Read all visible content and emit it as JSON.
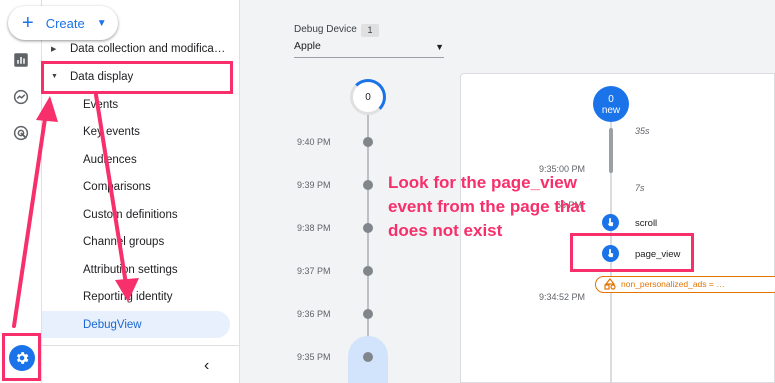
{
  "create_button": {
    "label": "Create",
    "icon": "plus-icon"
  },
  "rail": {
    "icons": [
      "home-icon",
      "reports-icon",
      "explore-icon",
      "advertising-icon"
    ],
    "settings_icon": "gear-icon"
  },
  "sidebar": {
    "items": [
      {
        "label": "Data collection and modifica…",
        "expanded": false
      },
      {
        "label": "Data display",
        "expanded": true
      }
    ],
    "children": [
      {
        "label": "Events"
      },
      {
        "label": "Key events"
      },
      {
        "label": "Audiences"
      },
      {
        "label": "Comparisons"
      },
      {
        "label": "Custom definitions"
      },
      {
        "label": "Channel groups"
      },
      {
        "label": "Attribution settings"
      },
      {
        "label": "Reporting identity"
      },
      {
        "label": "DebugView",
        "active": true
      }
    ],
    "collapse_icon": "chevron-left-icon"
  },
  "debug": {
    "device_label": "Debug Device",
    "device_count": "1",
    "device_value": "Apple"
  },
  "minutes": {
    "current_count": "0",
    "rows": [
      {
        "time": "9:40 PM"
      },
      {
        "time": "9:39 PM"
      },
      {
        "time": "9:38 PM"
      },
      {
        "time": "9:37 PM"
      },
      {
        "time": "9:36 PM"
      },
      {
        "time": "9:35 PM"
      }
    ]
  },
  "seconds": {
    "top_count": "0",
    "top_label": "new",
    "durations": [
      "35s",
      "7s"
    ],
    "times": [
      "9:35:00 PM",
      "53 PM",
      "9:34:52 PM"
    ],
    "events": [
      {
        "label": "scroll",
        "icon": "event-icon"
      },
      {
        "label": "page_view",
        "icon": "event-icon"
      }
    ],
    "warning": {
      "label": "non_personalized_ads = …",
      "icon": "warning-shapes-icon"
    }
  },
  "annotation": {
    "text": "Look for the page_view event from the page that does not exist",
    "color": "#f72f6b"
  },
  "colors": {
    "accent": "#1a73e8",
    "highlight": "#f72f6b",
    "warning": "#e37400"
  }
}
